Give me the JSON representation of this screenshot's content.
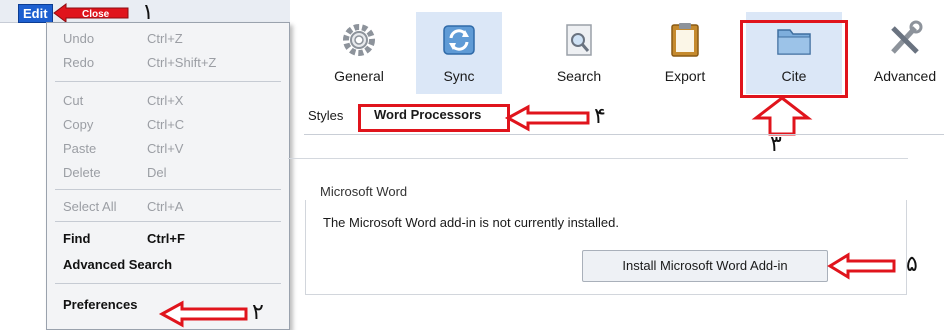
{
  "menubar": {
    "edit_label": "Edit",
    "close_label": "Close"
  },
  "menu": {
    "items": [
      {
        "label": "Undo",
        "shortcut": "Ctrl+Z"
      },
      {
        "label": "Redo",
        "shortcut": "Ctrl+Shift+Z"
      },
      {
        "label": "Cut",
        "shortcut": "Ctrl+X"
      },
      {
        "label": "Copy",
        "shortcut": "Ctrl+C"
      },
      {
        "label": "Paste",
        "shortcut": "Ctrl+V"
      },
      {
        "label": "Delete",
        "shortcut": "Del"
      },
      {
        "label": "Select All",
        "shortcut": "Ctrl+A"
      },
      {
        "label": "Find",
        "shortcut": "Ctrl+F"
      },
      {
        "label": "Advanced Search",
        "shortcut": ""
      },
      {
        "label": "Preferences",
        "shortcut": ""
      }
    ]
  },
  "toolbar": {
    "buttons": [
      {
        "label": "General",
        "icon": "gear-icon"
      },
      {
        "label": "Sync",
        "icon": "sync-icon"
      },
      {
        "label": "Search",
        "icon": "search-icon"
      },
      {
        "label": "Export",
        "icon": "clipboard-icon"
      },
      {
        "label": "Cite",
        "icon": "folder-icon"
      },
      {
        "label": "Advanced",
        "icon": "tools-icon"
      }
    ]
  },
  "tabs": {
    "styles": "Styles",
    "word_processors": "Word Processors"
  },
  "plugin": {
    "group_label": "Microsoft Word",
    "status": "The Microsoft Word add-in is not currently installed.",
    "install_button": "Install Microsoft Word Add-in"
  },
  "annotations": {
    "n1": "۱",
    "n2": "۲",
    "n3": "۳",
    "n4": "۴",
    "n5": "۵"
  },
  "colors": {
    "highlight": "#e0141c",
    "menu_accent": "#1d5fd0",
    "selected_tab": "#dbe7f7"
  }
}
